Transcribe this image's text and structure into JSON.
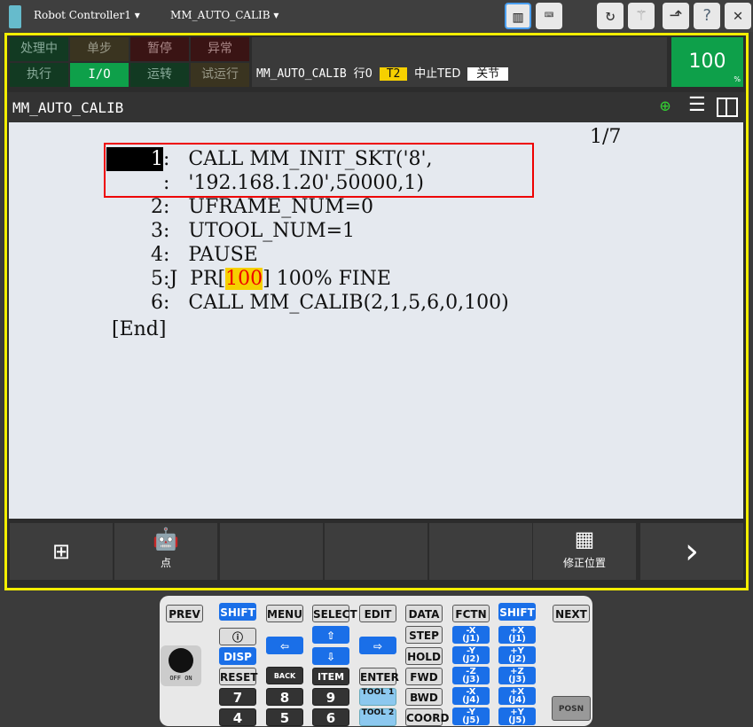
{
  "topbar": {
    "controller": "Robot Controller1",
    "program": "MM_AUTO_CALIB",
    "icons": [
      "pendant-icon",
      "keyboard-icon",
      "refresh-icon",
      "tree-icon",
      "export-icon",
      "help-icon",
      "close-icon"
    ]
  },
  "status": {
    "row1": [
      "处理中",
      "单步",
      "暂停",
      "异常"
    ],
    "row2": [
      "执行",
      "I/O",
      "运转",
      "试运行"
    ]
  },
  "info": {
    "program": "MM_AUTO_CALIB",
    "line": "行0",
    "mode": "T2",
    "state": "中止TED",
    "coord": "关节"
  },
  "speed": {
    "value": "100",
    "unit": "%"
  },
  "title": "MM_AUTO_CALIB",
  "editor": {
    "page": "1/7",
    "lines": [
      {
        "num": "1",
        "sep": ":",
        "code": "   CALL MM_INIT_SKT('8',"
      },
      {
        "num": "",
        "sep": ":",
        "code": "   '192.168.1.20',50000,1)"
      },
      {
        "num": "2",
        "sep": ":",
        "code": "   UFRAME_NUM=0"
      },
      {
        "num": "3",
        "sep": ":",
        "code": "   UTOOL_NUM=1"
      },
      {
        "num": "4",
        "sep": ":",
        "code": "   PAUSE"
      },
      {
        "num": "5",
        "sep": ":J",
        "code": "  PR[",
        "hl": "100",
        "after": "] 100% FINE"
      },
      {
        "num": "6",
        "sep": ":",
        "code": "   CALL MM_CALIB(2,1,5,6,0,100)"
      }
    ],
    "end": "[End]"
  },
  "fbar": [
    "",
    "点",
    "",
    "",
    "",
    "修正位置",
    ""
  ],
  "keys": {
    "prev": "PREV",
    "shift": "SHIFT",
    "menu": "MENU",
    "select": "SELECT",
    "edit": "EDIT",
    "data": "DATA",
    "fctn": "FCTN",
    "next": "NEXT",
    "step": "STEP",
    "hold": "HOLD",
    "fwd": "FWD",
    "bwd": "BWD",
    "coord": "COORD",
    "reset": "RESET",
    "back": "BACK SPACE",
    "item": "ITEM",
    "enter": "ENTER",
    "disp": "DISP",
    "tool1": "TOOL 1",
    "tool2": "TOOL 2",
    "n7": "7",
    "n8": "8",
    "n9": "9",
    "n4": "4",
    "n5": "5",
    "n6": "6",
    "posn": "POSN",
    "off": "OFF",
    "on": "ON",
    "jog": [
      [
        "-X",
        "(J1)",
        "+X",
        "(J1)"
      ],
      [
        "-Y",
        "(J2)",
        "+Y",
        "(J2)"
      ],
      [
        "-Z",
        "(J3)",
        "+Z",
        "(J3)"
      ],
      [
        "-X",
        "(J4)",
        "+X",
        "(J4)"
      ],
      [
        "-Y",
        "(J5)",
        "+Y",
        "(J5)"
      ]
    ]
  }
}
